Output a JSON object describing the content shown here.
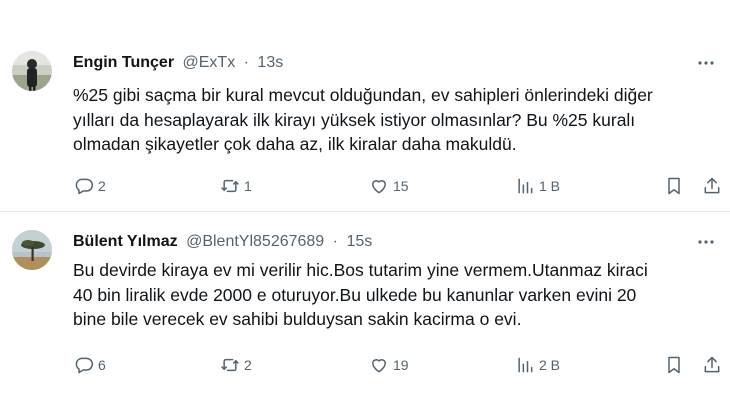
{
  "tweets": [
    {
      "author_name": "Engin Tunçer",
      "handle": "@ExTx",
      "separator": "·",
      "time": "13s",
      "lines": [
        "%25 gibi saçma bir kural mevcut olduğundan, ev sahipleri önlerindeki diğer",
        "yılları da hesaplayarak ilk kirayı yüksek istiyor olmasınlar? Bu %25 kuralı",
        "olmadan şikayetler çok daha az, ilk kiralar daha makuldü."
      ],
      "replies": "2",
      "retweets": "1",
      "likes": "15",
      "views": "1 B"
    },
    {
      "author_name": "Bülent Yılmaz",
      "handle": "@BlentYl85267689",
      "separator": "·",
      "time": "15s",
      "lines": [
        "Bu devirde kiraya ev mi verilir hic.Bos tutarim yine vermem.Utanmaz kiraci",
        "40 bin liralik evde 2000 e oturuyor.Bu ulkede bu kanunlar varken evini 20",
        "bine bile verecek ev sahibi bulduysan sakin kacirma o evi."
      ],
      "replies": "6",
      "retweets": "2",
      "likes": "19",
      "views": "2 B"
    }
  ],
  "icons": {
    "reply": "reply-icon",
    "retweet": "retweet-icon",
    "like": "heart-icon",
    "views": "views-icon",
    "bookmark": "bookmark-icon",
    "share": "share-icon",
    "more": "more-icon"
  },
  "colors": {
    "text": "#0f1419",
    "secondary": "#536471",
    "divider": "#e6e9eb"
  }
}
